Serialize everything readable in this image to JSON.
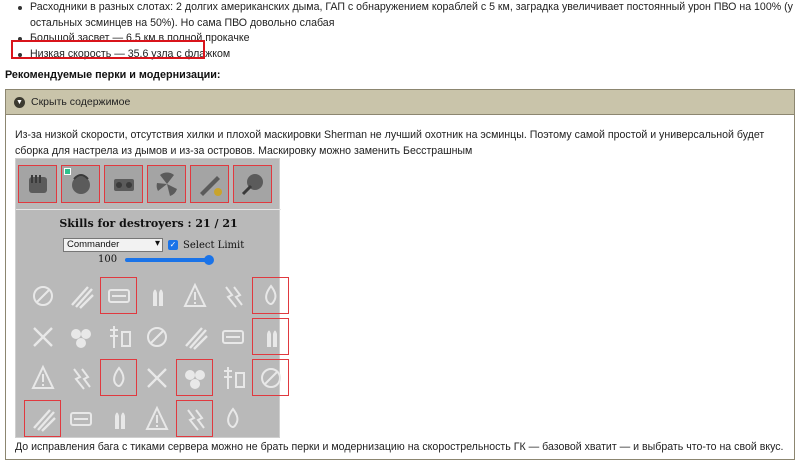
{
  "bullets": [
    "Расходники в разных слотах: 2 долгих американских дыма, ГАП с обнаружением кораблей с 5 км, заградка увеличивает постоянный урон ПВО на 100% (у остальных эсминцев на 50%). Но сама ПВО довольно слабая",
    "Большой засвет — 6.5 км в полной прокачке",
    "Низкая скорость — 35.6 узла с флажком"
  ],
  "perk_title": "Рекомендуемые перки и модернизации:",
  "spoiler": {
    "toggle_label": "Скрыть содержимое",
    "text": "Из-за низкой скорости, отсутствия хилки и плохой маскировки Sherman не лучший охотник на эсминцы. Поэтому самой простой и универсальной будет сборка для настрела из дымов и из-за островов. Маскировку можно заменить Бесстрашным",
    "footer": "До исправления бага с тиками сервера можно не брать перки и модернизацию на скорострельность ГК — базовой хватит — и выбрать что-то на свой вкус."
  },
  "calculator": {
    "skills_title": "Skills for destroyers : 21 / 21",
    "commander_selected": "Commander",
    "select_limit_label": "Select Limit",
    "select_limit_checked": true,
    "slider_value": "100",
    "slider_level": 1.0,
    "upgrades": [
      {
        "icon": "main-battery-mod-icon",
        "special": false
      },
      {
        "icon": "special-upgrade-icon",
        "special": true
      },
      {
        "icon": "steering-gear-icon",
        "special": false
      },
      {
        "icon": "propulsion-mod-icon",
        "special": false
      },
      {
        "icon": "gun-reload-mod-icon",
        "special": false
      },
      {
        "icon": "concealment-mod-icon",
        "special": false
      }
    ],
    "skills": [
      {
        "icon": "grease-the-gears-icon",
        "selected": false
      },
      {
        "icon": "consumables-specialist-icon",
        "selected": false
      },
      {
        "icon": "last-stand-icon",
        "selected": true
      },
      {
        "icon": "he-shell-icon",
        "selected": false
      },
      {
        "icon": "ap-shell-icon",
        "selected": false
      },
      {
        "icon": "priority-target-icon",
        "selected": false
      },
      {
        "icon": "incoming-fire-alert-icon",
        "selected": true
      },
      {
        "icon": "fire-prevention-icon",
        "selected": false
      },
      {
        "icon": "consumables-enhancements-icon",
        "selected": false
      },
      {
        "icon": "extra-heavy-ammo-icon",
        "selected": false
      },
      {
        "icon": "demolition-expert-icon",
        "selected": false
      },
      {
        "icon": "dazzle-icon",
        "selected": false
      },
      {
        "icon": "vigilance-warning-icon",
        "selected": false
      },
      {
        "icon": "survivability-expert-icon",
        "selected": true
      },
      {
        "icon": "aa-defense-icon",
        "selected": false
      },
      {
        "icon": "swift-fish-icon",
        "selected": false
      },
      {
        "icon": "main-battery-expert-icon",
        "selected": true
      },
      {
        "icon": "fearless-brawler-icon",
        "selected": false
      },
      {
        "icon": "superintendent-icon",
        "selected": true
      },
      {
        "icon": "adrenaline-rush-icon",
        "selected": false
      },
      {
        "icon": "concealment-expert-icon",
        "selected": true
      },
      {
        "icon": "manual-aa-icon",
        "selected": true
      },
      {
        "icon": "propulsion-repair-icon",
        "selected": false
      },
      {
        "icon": "radio-location-icon",
        "selected": false
      },
      {
        "icon": "dead-eye-icon",
        "selected": false
      },
      {
        "icon": "radio-warning-icon",
        "selected": true
      },
      {
        "icon": "heavy-aa-icon",
        "selected": false
      }
    ]
  }
}
